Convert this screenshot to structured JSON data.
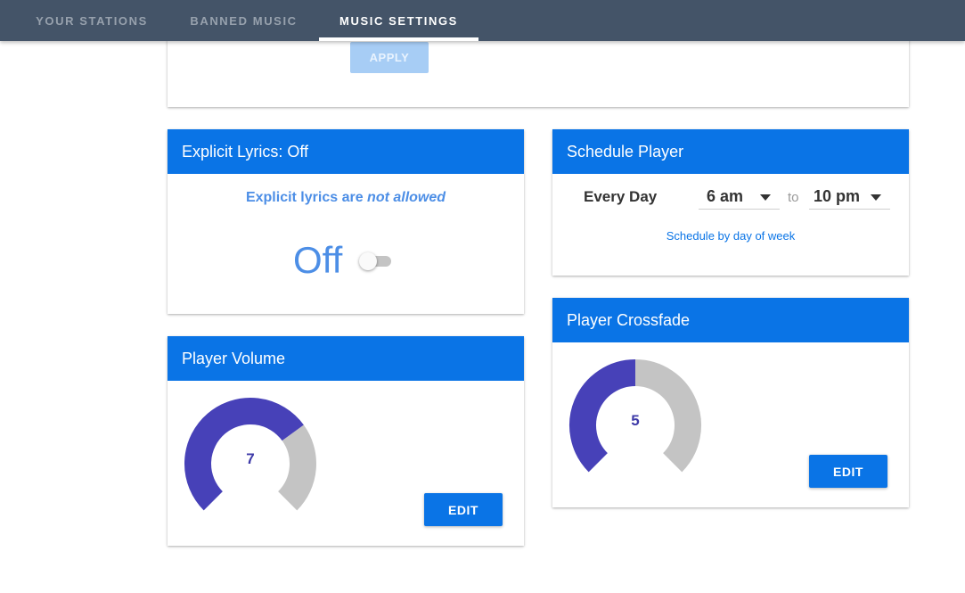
{
  "nav": {
    "tabs": [
      {
        "label": "YOUR STATIONS",
        "active": false
      },
      {
        "label": "BANNED MUSIC",
        "active": false
      },
      {
        "label": "MUSIC SETTINGS",
        "active": true
      }
    ]
  },
  "top_card": {
    "apply_label": "APPLY"
  },
  "explicit": {
    "title": "Explicit Lyrics: Off",
    "message_prefix": "Explicit lyrics are",
    "message_emphasis": "not allowed",
    "state_label": "Off",
    "enabled": false
  },
  "volume": {
    "title": "Player Volume",
    "value": "7",
    "max": 10,
    "edit_label": "EDIT"
  },
  "schedule": {
    "title": "Schedule Player",
    "day_label": "Every Day",
    "start": "6 am",
    "to_label": "to",
    "end": "10 pm",
    "link_label": "Schedule by day of week"
  },
  "crossfade": {
    "title": "Player Crossfade",
    "value": "5",
    "max": 10,
    "edit_label": "EDIT"
  },
  "colors": {
    "nav_bg": "#445468",
    "header_blue": "#0a74e6",
    "gauge_fill": "#4741b8",
    "gauge_track": "#c4c4c4",
    "text_blue": "#4c8ee6"
  }
}
